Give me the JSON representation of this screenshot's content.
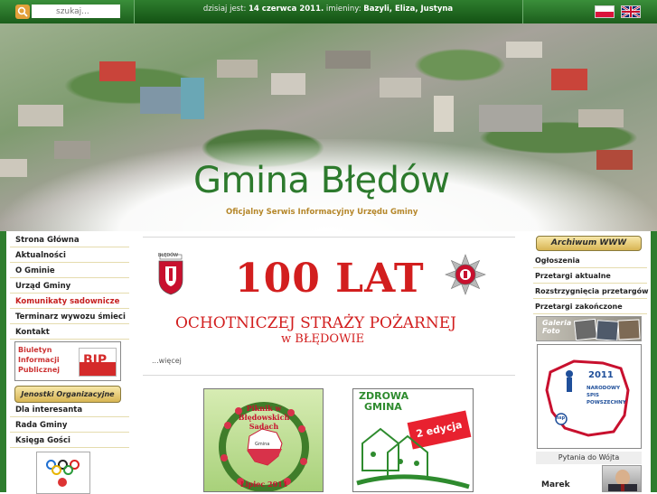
{
  "topbar": {
    "search_placeholder": "szukaj...",
    "date_prefix": "dzisiaj jest:",
    "date": "14 czerwca 2011.",
    "nameday_prefix": "imieniny:",
    "namedays": "Bazyli, Eliza, Justyna"
  },
  "header": {
    "title": "Gmina Błędów",
    "subtitle": "Oficjalny Serwis Informacyjny Urzędu Gminy"
  },
  "left_menu": {
    "items": [
      {
        "label": "Strona Główna"
      },
      {
        "label": "Aktualności"
      },
      {
        "label": "O Gminie"
      },
      {
        "label": "Urząd Gminy"
      },
      {
        "label": "Komunikaty sadownicze"
      },
      {
        "label": "Terminarz wywozu śmieci"
      },
      {
        "label": "Kontakt"
      }
    ],
    "bip_text": "Biuletyn Informacji Publicznej",
    "bip_logo": "BIP",
    "jednostki_label": "Jenostki Organizacyjne",
    "items2": [
      {
        "label": "Dla interesanta"
      },
      {
        "label": "Rada Gminy"
      },
      {
        "label": "Księga Gości"
      }
    ]
  },
  "main": {
    "banner_big": "100 LAT",
    "banner_line": "OCHOTNICZEJ STRAŻY POŻARNEJ",
    "banner_place": "w BŁĘDOWIE",
    "coat_label": "BŁĘDÓW",
    "more_link": "...więcej",
    "piknik_title": "Piknik w Błędowskich Sadach",
    "piknik_center": "Gmina",
    "piknik_date": "Lipiec 2011",
    "zdrowa_title_1": "ZDROWA",
    "zdrowa_title_2": "GMINA",
    "zdrowa_edition": "2 edycja"
  },
  "right_menu": {
    "archiwum_label": "Archiwum WWW",
    "items": [
      {
        "label": "Ogłoszenia"
      },
      {
        "label": "Przetargi aktualne"
      },
      {
        "label": "Rozstrzygnięcia przetargów"
      },
      {
        "label": "Przetargi zakończone"
      }
    ],
    "galeria_label": "Galeria Foto",
    "nsp_year": "2011",
    "nsp_text": "NARODOWY SPIS POWSZECHNY",
    "nsp_short": "nsp",
    "pytania_label": "Pytania do Wójta",
    "wojt_name": "Marek"
  },
  "colors": {
    "brand_green": "#2e7d2e",
    "title_green": "#2d7a2d",
    "accent_gold": "#d8b554",
    "banner_red": "#d21e1e"
  },
  "icons": {
    "search": "magnifier-icon",
    "flag_pl": "flag-pl-icon",
    "flag_en": "flag-en-icon"
  }
}
